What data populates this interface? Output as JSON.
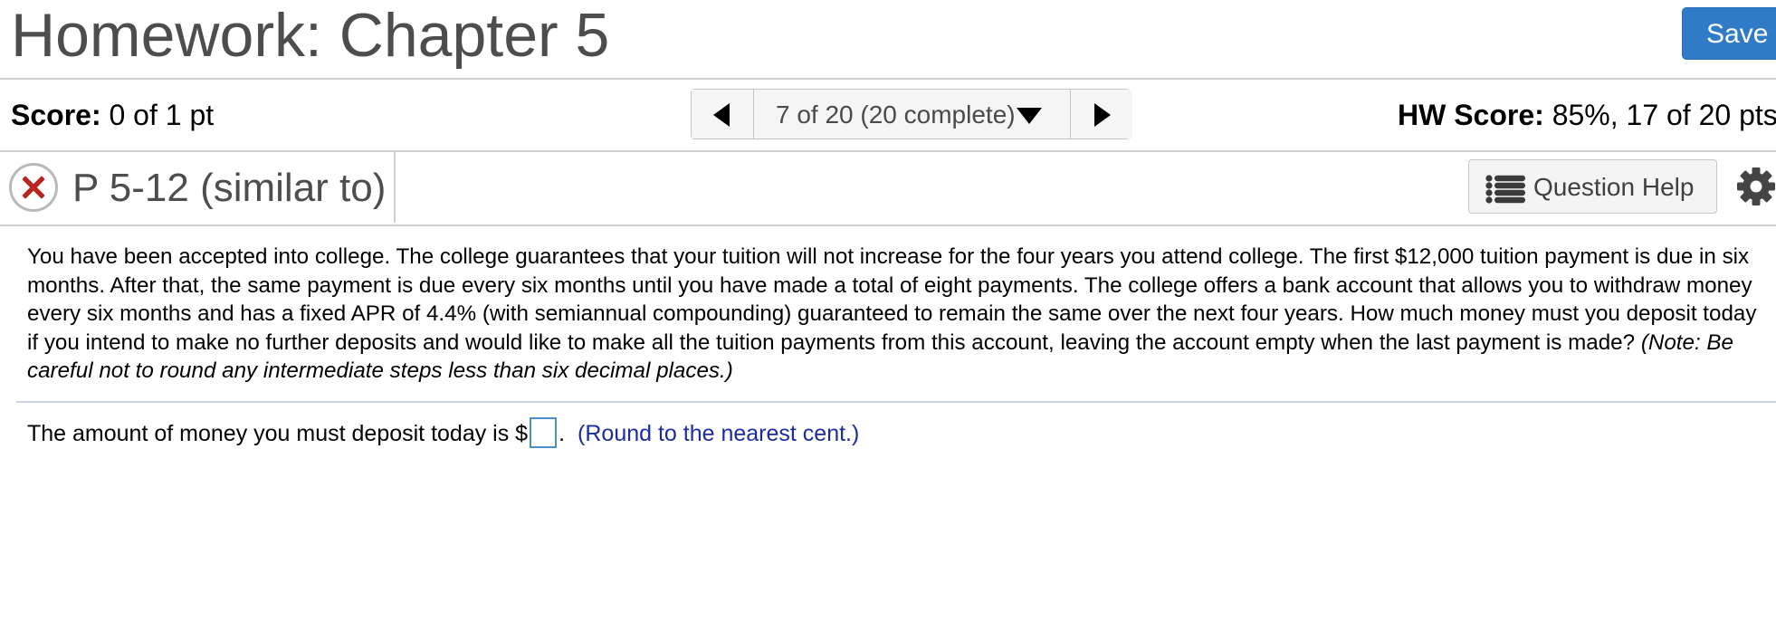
{
  "header": {
    "title": "Homework: Chapter 5",
    "save_label": "Save"
  },
  "score_bar": {
    "score_label": "Score:",
    "score_value": " 0 of 1 pt",
    "nav_position": "7 of 20 (20 complete)",
    "hw_score_label": "HW Score:",
    "hw_score_value": " 85%, 17 of 20 pts"
  },
  "question": {
    "status": "incorrect",
    "title": "P 5-12 (similar to)",
    "help_label": "Question Help",
    "text": "You have been accepted into college. The college guarantees that your tuition will not increase for the four years you attend college. The first $12,000 tuition payment is due in six months. After that, the same payment is due every six months until you have made a total of eight payments. The college offers a bank account that allows you to withdraw money every six months and has a fixed APR of 4.4% (with semiannual compounding) guaranteed to remain the same over the next four years. How much money must you deposit today if you intend to make no further deposits and would like to make all the tuition payments from this account, leaving the account empty when the last payment is made?",
    "note": "(Note: Be careful not to round any intermediate steps less than six decimal places.)"
  },
  "answer": {
    "prompt": "The amount of money you must deposit today is $",
    "value": "",
    "suffix": ".",
    "round_note": "(Round to the nearest cent.)"
  },
  "colors": {
    "save_button": "#2f7bc8",
    "incorrect_icon": "#d9302c",
    "round_note": "#1c2ba0",
    "input_border": "#4b8ed0"
  },
  "icons": {
    "status": "incorrect-x-icon",
    "prev": "triangle-left-icon",
    "next": "triangle-right-icon",
    "dropdown": "triangle-down-icon",
    "help": "list-icon",
    "settings": "gear-icon"
  }
}
